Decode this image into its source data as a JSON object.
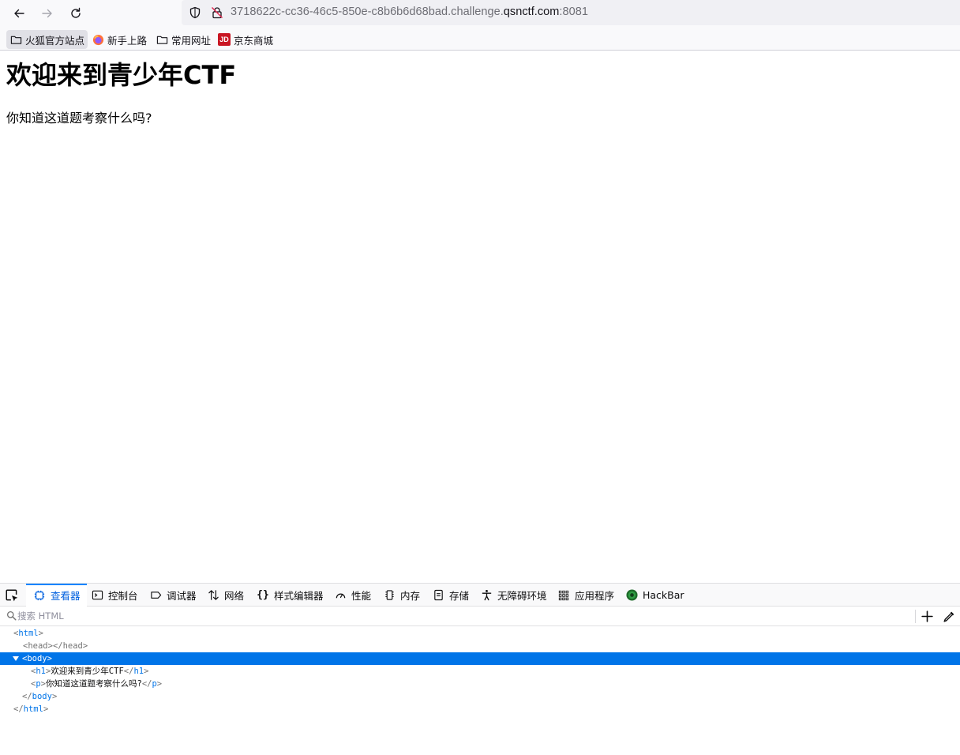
{
  "browser": {
    "url": {
      "prefix": "3718622c-cc36-46c5-850e-c8b6b6d68bad.challenge.",
      "domain": "qsnctf.com",
      "port": ":8081"
    },
    "bookmarks": [
      {
        "label": "火狐官方站点",
        "icon": "folder-icon"
      },
      {
        "label": "新手上路",
        "icon": "firefox-icon"
      },
      {
        "label": "常用网址",
        "icon": "folder-icon"
      },
      {
        "label": "京东商城",
        "icon": "jd-icon",
        "badge": "JD",
        "color": "#c91623"
      }
    ]
  },
  "page": {
    "heading": "欢迎来到青少年CTF",
    "paragraph": "你知道这道题考察什么吗?"
  },
  "devtools": {
    "tabs": [
      {
        "label": "查看器",
        "icon": "inspector-icon",
        "selected": true
      },
      {
        "label": "控制台",
        "icon": "console-icon"
      },
      {
        "label": "调试器",
        "icon": "debugger-icon"
      },
      {
        "label": "网络",
        "icon": "network-icon"
      },
      {
        "label": "样式编辑器",
        "icon": "style-editor-icon"
      },
      {
        "label": "性能",
        "icon": "performance-icon"
      },
      {
        "label": "内存",
        "icon": "memory-icon"
      },
      {
        "label": "存储",
        "icon": "storage-icon"
      },
      {
        "label": "无障碍环境",
        "icon": "accessibility-icon"
      },
      {
        "label": "应用程序",
        "icon": "application-icon"
      },
      {
        "label": "HackBar",
        "icon": "hackbar-icon"
      }
    ],
    "search_placeholder": "搜索 HTML",
    "markup": {
      "html_tag": "html",
      "head_tag": "head",
      "body_tag": "body",
      "h1_tag": "h1",
      "h1_text": "欢迎来到青少年CTF",
      "p_tag": "p",
      "p_text": "你知道这道题考察什么吗?"
    },
    "accent_color": "#0074e8"
  }
}
